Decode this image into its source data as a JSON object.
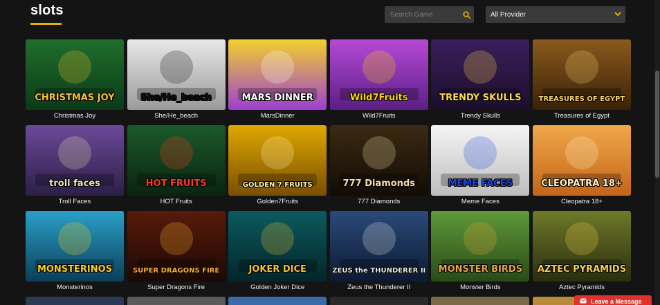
{
  "header": {
    "title": "slots",
    "search_placeholder": "Search Game",
    "provider_selected": "All Provider"
  },
  "colors": {
    "accent": "#e2b007",
    "background": "#141414",
    "control_bg": "#3a3a3a",
    "chat_red": "#e0322a"
  },
  "games": [
    {
      "name": "Christmas Joy",
      "art": "CHRISTMAS JOY",
      "bg1": "#1f6e2c",
      "bg2": "#0b3a18",
      "fg": "#f4c430"
    },
    {
      "name": "She/He_beach",
      "art": "She/He_beach",
      "bg1": "#e8e8e8",
      "bg2": "#9a9a9a",
      "fg": "#111111"
    },
    {
      "name": "MarsDinner",
      "art": "MARS DINNER",
      "bg1": "#f2d02c",
      "bg2": "#9c3fd0",
      "fg": "#ffffff"
    },
    {
      "name": "Wild7Fruits",
      "art": "Wild7Fruits",
      "bg1": "#b64ad6",
      "bg2": "#5a1e86",
      "fg": "#ffd400"
    },
    {
      "name": "Trendy Skulls",
      "art": "TRENDY SKULLS",
      "bg1": "#3b1e5c",
      "bg2": "#1b0f2b",
      "fg": "#ffd94a"
    },
    {
      "name": "Treasures of Egypt",
      "art": "TREASURES OF EGYPT",
      "bg1": "#8a5a1e",
      "bg2": "#3a2206",
      "fg": "#f4d06a"
    },
    {
      "name": "Troll Faces",
      "art": "troll faces",
      "bg1": "#6b4a9a",
      "bg2": "#2c1f46",
      "fg": "#f1e3b5"
    },
    {
      "name": "HOT Fruits",
      "art": "HOT FRUITS",
      "bg1": "#1b5a2a",
      "bg2": "#0a2410",
      "fg": "#ff3b1f"
    },
    {
      "name": "Golden7Fruits",
      "art": "GOLDEN 7 FRUITS",
      "bg1": "#e0a800",
      "bg2": "#7a4e00",
      "fg": "#fff2a8"
    },
    {
      "name": "777 Diamonds",
      "art": "777 Diamonds",
      "bg1": "#3a2a12",
      "bg2": "#120c05",
      "fg": "#f6e2a8"
    },
    {
      "name": "Meme Faces",
      "art": "MEME FACES",
      "bg1": "#f5f5f5",
      "bg2": "#bdbdbd",
      "fg": "#2046d8"
    },
    {
      "name": "Cleopatra 18+",
      "art": "CLEOPATRA 18+",
      "bg1": "#f0a84a",
      "bg2": "#c46418",
      "fg": "#fff2c2"
    },
    {
      "name": "Monsterinos",
      "art": "MONSTERINOS",
      "bg1": "#2aa0c8",
      "bg2": "#0b3e58",
      "fg": "#f8d21c"
    },
    {
      "name": "Super Dragons Fire",
      "art": "SUPER DRAGONS FIRE",
      "bg1": "#5a1a0c",
      "bg2": "#1a0804",
      "fg": "#ffb22c"
    },
    {
      "name": "Golden Joker Dice",
      "art": "JOKER DICE",
      "bg1": "#0c5a5e",
      "bg2": "#03262a",
      "fg": "#f4c430"
    },
    {
      "name": "Zeus the Thunderer II",
      "art": "ZEUS the THUNDERER II",
      "bg1": "#2b4a7a",
      "bg2": "#0c1a32",
      "fg": "#e8e8e8"
    },
    {
      "name": "Monster Birds",
      "art": "MONSTER BIRDS",
      "bg1": "#5f9a3a",
      "bg2": "#2a4a18",
      "fg": "#e8a838"
    },
    {
      "name": "Aztec Pyramids",
      "art": "AZTEC PYRAMIDS",
      "bg1": "#6e7a2a",
      "bg2": "#2a2e0c",
      "fg": "#f4d04a"
    }
  ],
  "next_row_colors": [
    "#2a3a52",
    "#5a5a5a",
    "#3a6aa8",
    "#2a2a2a",
    "#7a6a4a",
    "#b88a3a"
  ],
  "chat": {
    "label": "Leave a Message"
  }
}
